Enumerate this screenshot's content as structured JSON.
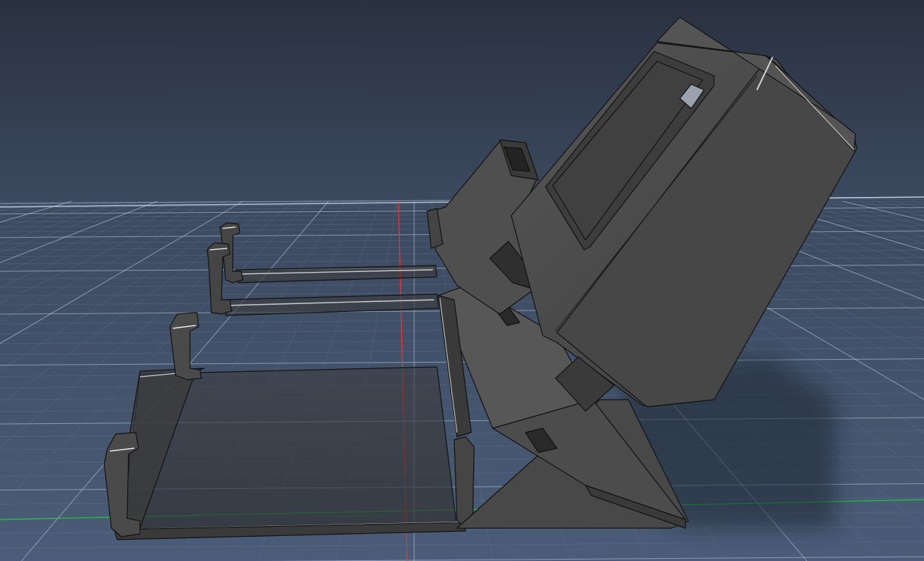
{
  "viewport": {
    "view": "3d-cad-model-viewport",
    "background_top": "#2a3140",
    "background_mid": "#3c4a60",
    "background_bottom": "#4a5c77",
    "ground_grid": "on",
    "grid_minor_color": "#6f88a7",
    "grid_major_color": "#c9d6e6",
    "x_axis_color": "#20c83a",
    "y_axis_color": "#ff3030"
  },
  "model": {
    "body_color": "#4a4a4a",
    "face_light": "#5a5a5a",
    "face_dark": "#2f2f2f",
    "edge_color": "#111111",
    "highlight_color": "#e6e6e6",
    "parts": [
      {
        "name": "enclosure-box",
        "icon": "box-shape"
      },
      {
        "name": "support-arm",
        "icon": "arm-shape"
      },
      {
        "name": "angled-ramp",
        "icon": "ramp-shape"
      },
      {
        "name": "front-tray",
        "icon": "tray-shape"
      },
      {
        "name": "rear-rails",
        "icon": "rail-shape"
      }
    ]
  }
}
